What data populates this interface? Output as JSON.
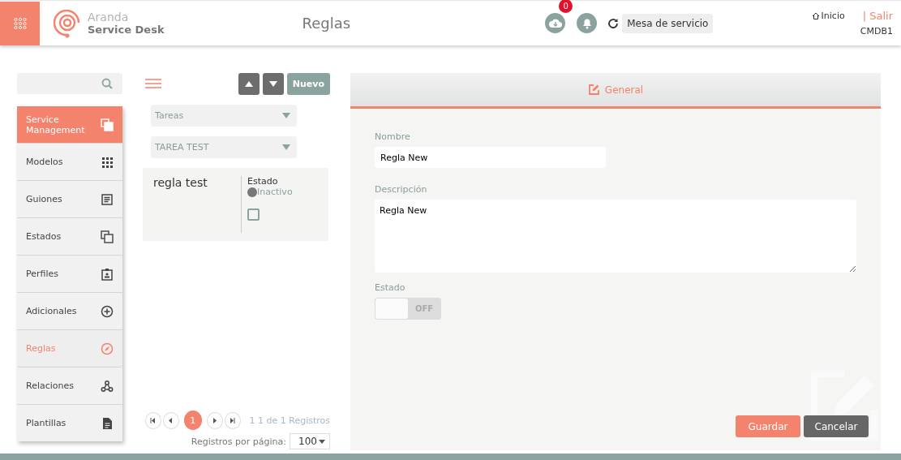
{
  "header": {
    "brand_top": "Aranda",
    "brand_bottom": "Service Desk",
    "page_title": "Reglas",
    "download_badge": "0",
    "service_select": "Mesa de servicio",
    "home_link": "Inicio",
    "logout_link": "| Salir",
    "user": "CMDB1"
  },
  "sidebar": {
    "items": [
      {
        "label": "Service Management",
        "kind": "header",
        "selected": false
      },
      {
        "label": "Modelos",
        "kind": "item",
        "selected": false
      },
      {
        "label": "Guiones",
        "kind": "item",
        "selected": false
      },
      {
        "label": "Estados",
        "kind": "item",
        "selected": false
      },
      {
        "label": "Perfiles",
        "kind": "item",
        "selected": false
      },
      {
        "label": "Adicionales",
        "kind": "item",
        "selected": false
      },
      {
        "label": "Reglas",
        "kind": "item",
        "selected": true
      },
      {
        "label": "Relaciones",
        "kind": "item",
        "selected": false
      },
      {
        "label": "Plantillas",
        "kind": "item",
        "selected": false
      }
    ]
  },
  "list": {
    "new_button": "Nuevo",
    "filters": [
      {
        "value": "Tareas"
      },
      {
        "value": "TAREA TEST"
      }
    ],
    "records": [
      {
        "name": "regla test",
        "state_label": "Estado",
        "state": "Inactivo",
        "active": false,
        "checked": false
      }
    ],
    "pagination": {
      "pages": [
        {
          "label": "1",
          "selected": true
        }
      ],
      "summary": "1 1 de 1 Registros",
      "per_page_label": "Registros por página:",
      "per_page": "100"
    }
  },
  "form": {
    "tab": "General",
    "fields": [
      {
        "label": "Nombre",
        "value": "Regla New",
        "kind": "input"
      },
      {
        "label": "Descripción",
        "value": "Regla New",
        "kind": "textarea"
      }
    ],
    "state": {
      "label": "Estado",
      "on": false,
      "off_text": "OFF"
    },
    "buttons": [
      {
        "label": "Guardar",
        "kind": "primary"
      },
      {
        "label": "Cancelar",
        "kind": "secondary"
      }
    ]
  }
}
